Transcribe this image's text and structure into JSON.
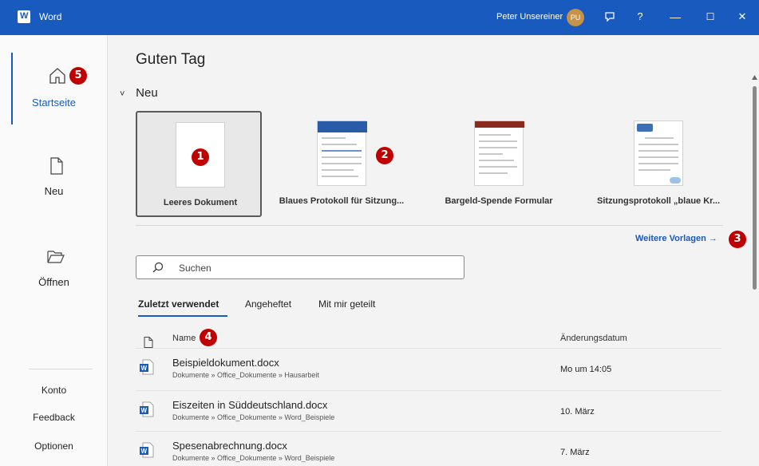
{
  "titlebar": {
    "app_name": "Word",
    "user_name": "Peter Unsereiner",
    "user_initials": "PU",
    "help": "?",
    "minimize": "—",
    "maximize": "☐",
    "close": "✕"
  },
  "sidebar": {
    "items": [
      {
        "label": "Startseite",
        "icon": "home-icon",
        "active": true
      },
      {
        "label": "Neu",
        "icon": "new-document-icon"
      },
      {
        "label": "Öffnen",
        "icon": "folder-open-icon"
      }
    ],
    "bottom_links": [
      "Konto",
      "Feedback",
      "Optionen"
    ]
  },
  "main": {
    "greeting": "Guten Tag",
    "new_section": {
      "chevron": "˅",
      "title": "Neu",
      "templates": [
        {
          "label": "Leeres Dokument",
          "selected": true
        },
        {
          "label": "Blaues Protokoll für Sitzung..."
        },
        {
          "label": "Bargeld-Spende Formular"
        },
        {
          "label": "Sitzungsprotokoll „blaue Kr..."
        }
      ],
      "more_templates": "Weitere Vorlagen →"
    },
    "search": {
      "placeholder": "Suchen"
    },
    "tabs": [
      "Zuletzt verwendet",
      "Angeheftet",
      "Mit mir geteilt"
    ],
    "table": {
      "col_name": "Name",
      "col_date": "Änderungsdatum",
      "rows": [
        {
          "name": "Beispieldokument.docx",
          "path": "Dokumente » Office_Dokumente » Hausarbeit",
          "date": "Mo um 14:05"
        },
        {
          "name": "Eiszeiten in Süddeutschland.docx",
          "path": "Dokumente » Office_Dokumente » Word_Beispiele",
          "date": "10. März"
        },
        {
          "name": "Spesenabrechnung.docx",
          "path": "Dokumente » Office_Dokumente » Word_Beispiele",
          "date": "7. März"
        }
      ]
    }
  },
  "annotations": [
    "1",
    "2",
    "3",
    "4",
    "5"
  ],
  "colors": {
    "brand": "#185abd",
    "badge": "#c00000"
  }
}
